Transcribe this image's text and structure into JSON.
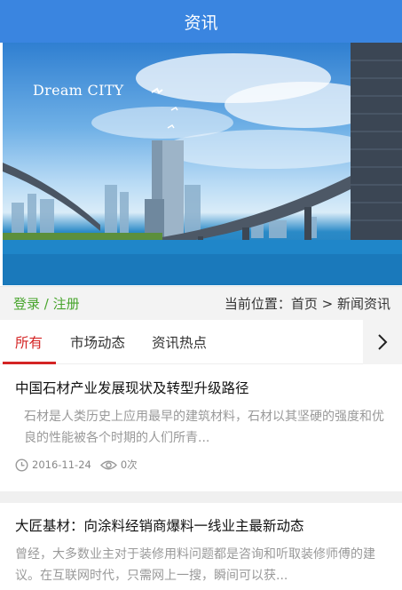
{
  "header": {
    "title": "资讯"
  },
  "banner": {
    "title": "Dream CITY",
    "subtitle": "",
    "icon": "city-banner-image"
  },
  "location_bar": {
    "login_label": "登录 / 注册",
    "breadcrumb": "当前位置：首页 > 新闻资讯"
  },
  "colors": {
    "header": "#3a85e0",
    "active_tab": "#d42424",
    "login": "#49a52e"
  },
  "tabs": [
    {
      "label": "所有",
      "active": true
    },
    {
      "label": "市场动态",
      "active": false
    },
    {
      "label": "资讯热点",
      "active": false
    }
  ],
  "tab_more_icon": "chevron-right-icon",
  "articles": [
    {
      "title": "中国石材产业发展现状及转型升级路径",
      "desc": "石材是人类历史上应用最早的建筑材料，石材以其坚硬的强度和优良的性能被各个时期的人们所青...",
      "date": "2016-11-24",
      "views": "0次"
    },
    {
      "title": "大匠基材：向涂料经销商爆料一线业主最新动态",
      "desc": "曾经，大多数业主对于装修用料问题都是咨询和听取装修师傅的建议。在互联网时代，只需网上一搜，瞬间可以获..."
    }
  ]
}
